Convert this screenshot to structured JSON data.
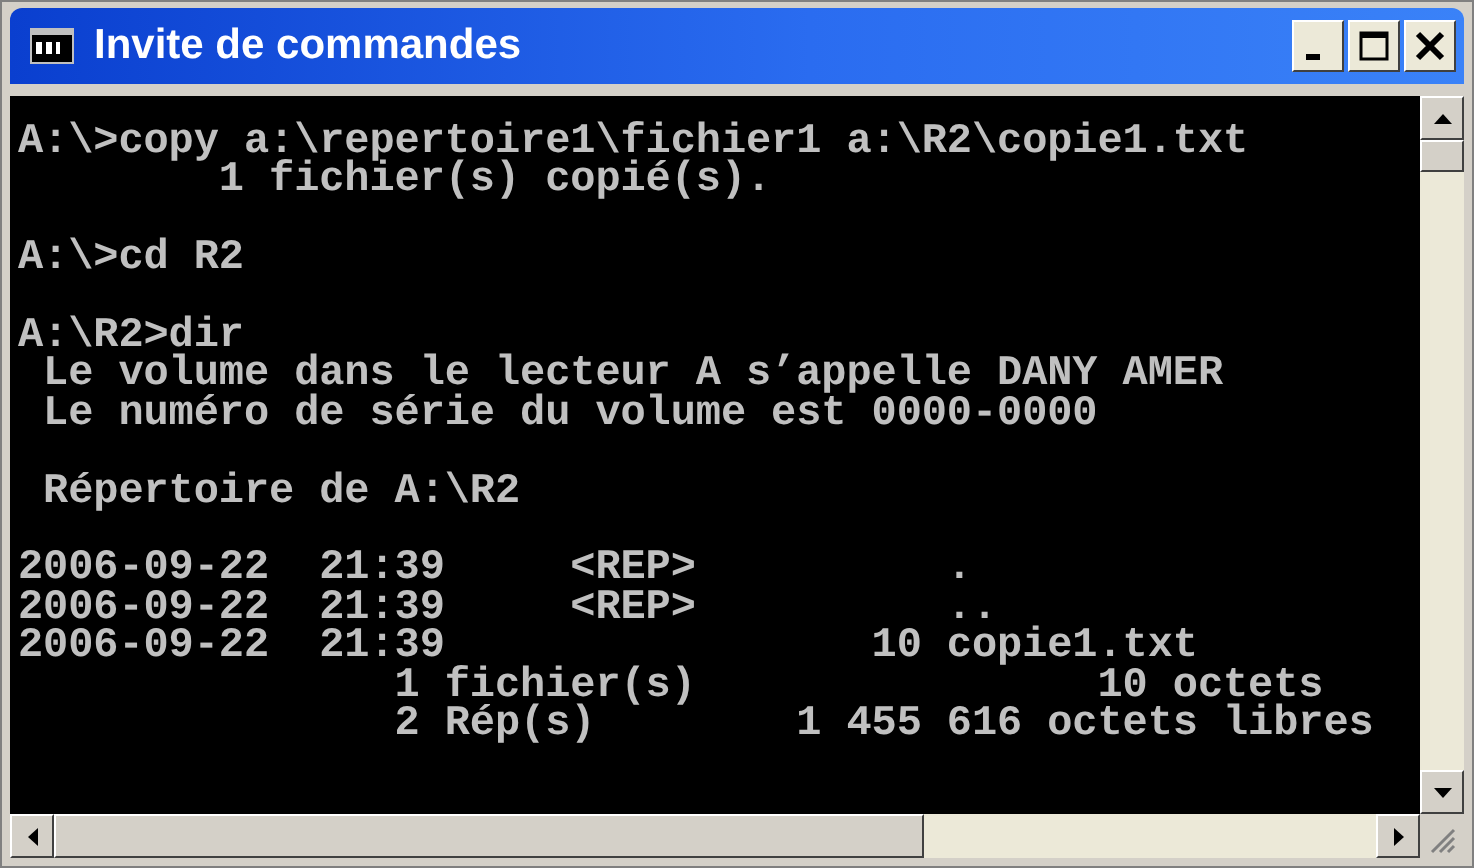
{
  "window": {
    "title": "Invite de commandes"
  },
  "console": {
    "blocks": [
      {
        "lines": [
          "A:\\>copy a:\\repertoire1\\fichier1 a:\\R2\\copie1.txt",
          "        1 fichier(s) copié(s)."
        ]
      },
      {
        "lines": [
          "A:\\>cd R2"
        ]
      },
      {
        "lines": [
          "A:\\R2>dir",
          " Le volume dans le lecteur A s’appelle DANY AMER",
          " Le numéro de série du volume est 0000-0000"
        ]
      },
      {
        "lines": [
          " Répertoire de A:\\R2"
        ]
      },
      {
        "lines": [
          "2006-09-22  21:39     <REP>          .",
          "2006-09-22  21:39     <REP>          ..",
          "2006-09-22  21:39                 10 copie1.txt",
          "               1 fichier(s)                10 octets",
          "               2 Rép(s)        1 455 616 octets libres"
        ]
      }
    ]
  }
}
